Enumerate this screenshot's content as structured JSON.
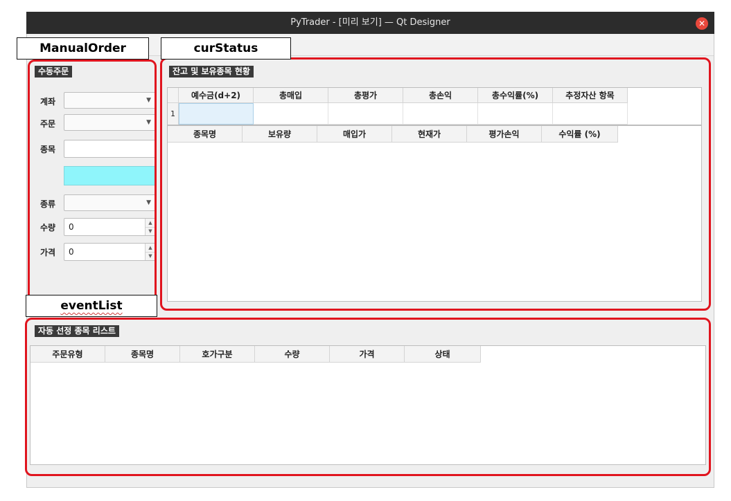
{
  "window": {
    "title": "PyTrader - [미리 보기] — Qt Designer",
    "close_glyph": "✕"
  },
  "annotations": {
    "manual": "ManualOrder",
    "cur": "curStatus",
    "event": "eventList"
  },
  "manual_order": {
    "group_title": "수동주문",
    "account_label": "계좌",
    "order_label": "주문",
    "stock_label": "종목",
    "stock_value": "",
    "type_label": "종류",
    "qty_label": "수량",
    "qty_value": "0",
    "price_label": "가격",
    "price_value": "0",
    "highlight_color": "#8ff5fb"
  },
  "cur_status": {
    "group_title": "잔고 및 보유종목 현황",
    "balance_headers": [
      "예수금(d+2)",
      "총매입",
      "총평가",
      "총손익",
      "총수익률(%)",
      "추정자산 항목"
    ],
    "row_number": "1",
    "holding_headers": [
      "종목명",
      "보유량",
      "매입가",
      "현재가",
      "평가손익",
      "수익률 (%)"
    ]
  },
  "event_list": {
    "group_title": "자동 선정 종목 리스트",
    "headers": [
      "주문유형",
      "종목명",
      "호가구분",
      "수량",
      "가격",
      "상태"
    ]
  },
  "colors": {
    "annotation_outline": "#e0141e",
    "titlebar": "#2c2c2c",
    "close": "#e8483c"
  }
}
